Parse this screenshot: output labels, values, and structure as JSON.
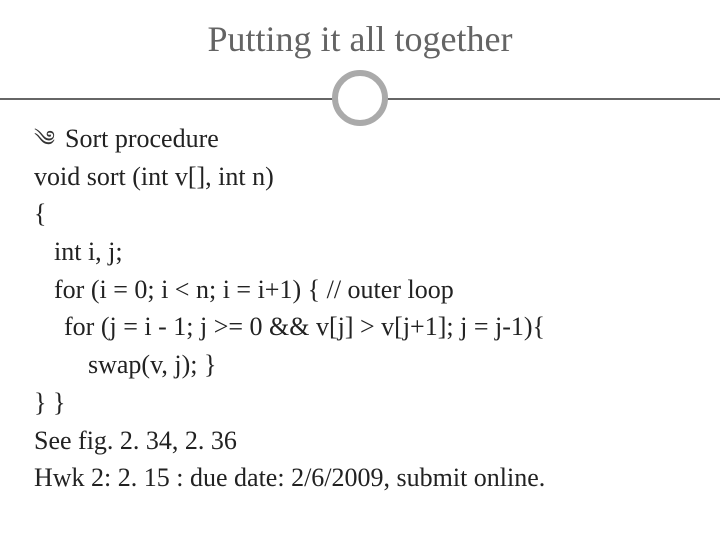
{
  "title": "Putting it all together",
  "bullet": "Sort procedure",
  "code": [
    "void sort (int v[], int n)",
    "{",
    "int i, j;",
    "for (i = 0; i < n; i = i+1)  { // outer loop",
    "for (j = i - 1; j >= 0 && v[j] > v[j+1]; j = j-1){",
    "swap(v, j);  }",
    "} }"
  ],
  "ref": "See fig. 2. 34, 2. 36",
  "hwk": "Hwk 2: 2. 15 : due date: 2/6/2009, submit online."
}
